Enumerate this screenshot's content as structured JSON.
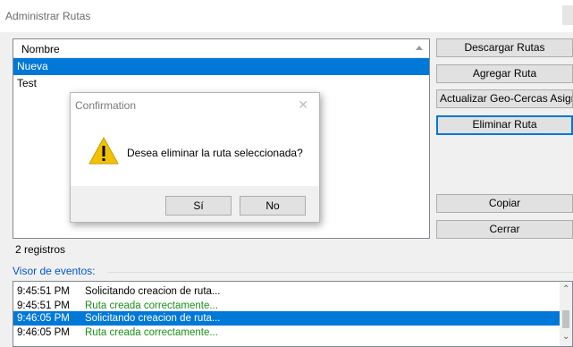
{
  "window": {
    "title": "Administrar Rutas"
  },
  "routes": {
    "column_header": "Nombre",
    "items": [
      {
        "label": "Nueva",
        "selected": true
      },
      {
        "label": "Test",
        "selected": false
      }
    ],
    "count_label": "2 registros"
  },
  "buttons": {
    "download": "Descargar Rutas",
    "add": "Agregar Ruta",
    "update_geofences": "Actualizar Geo-Cercas Asignadas",
    "delete": "Eliminar Ruta",
    "copy": "Copiar",
    "close": "Cerrar"
  },
  "events": {
    "group_label": "Visor de eventos:",
    "rows": [
      {
        "time": "9:45:51 PM",
        "message": "Solicitando creacion de ruta...",
        "status": "info",
        "selected": false
      },
      {
        "time": "9:45:51 PM",
        "message": "Ruta creada correctamente...",
        "status": "ok",
        "selected": false
      },
      {
        "time": "9:46:05 PM",
        "message": "Solicitando creacion de ruta...",
        "status": "info",
        "selected": true
      },
      {
        "time": "9:46:05 PM",
        "message": "Ruta creada correctamente...",
        "status": "ok",
        "selected": false
      }
    ]
  },
  "dialog": {
    "title": "Confirmation",
    "icon": "warning-icon",
    "message": "Desea eliminar la ruta seleccionada?",
    "yes_label": "Sí",
    "no_label": "No"
  },
  "colors": {
    "selection": "#0078d7",
    "success_text": "#1a8f1a",
    "group_label": "#0055cc",
    "warning": "#f2c200"
  }
}
